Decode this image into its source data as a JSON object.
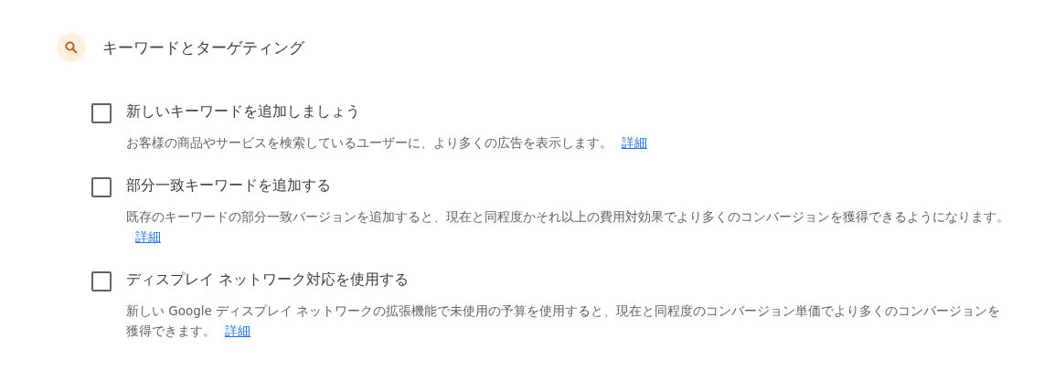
{
  "section": {
    "title": "キーワードとターゲティング"
  },
  "options": [
    {
      "label": "新しいキーワードを追加しましょう",
      "checked": false,
      "description": "お客様の商品やサービスを検索しているユーザーに、より多くの広告を表示します。",
      "link": "詳細"
    },
    {
      "label": "部分一致キーワードを追加する",
      "checked": false,
      "description": "既存のキーワードの部分一致バージョンを追加すると、現在と同程度かそれ以上の費用対効果でより多くのコンバージョンを獲得できるようになります。",
      "link": "詳細"
    },
    {
      "label": "ディスプレイ ネットワーク対応を使用する",
      "checked": false,
      "description": "新しい Google ディスプレイ ネットワークの拡張機能で未使用の予算を使用すると、現在と同程度のコンバージョン単価でより多くのコンバージョンを獲得できます。",
      "link": "詳細"
    }
  ]
}
